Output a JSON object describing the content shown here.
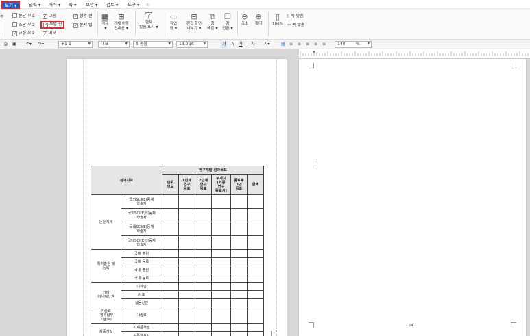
{
  "menubar": {
    "items": [
      {
        "label": "보기",
        "active": true
      },
      {
        "label": "입력"
      },
      {
        "label": "서식"
      },
      {
        "label": "쪽"
      },
      {
        "label": "보안"
      },
      {
        "label": "검토"
      },
      {
        "label": "도구"
      }
    ]
  },
  "ribbon": {
    "left_edge_label": "조",
    "checkboxes": [
      {
        "label": "문단 부호",
        "checked": false
      },
      {
        "label": "그림",
        "checked": true
      },
      {
        "label": "상황 선",
        "checked": true
      },
      {
        "label": "조판 부호",
        "checked": false
      },
      {
        "label": "투명 선",
        "checked": true,
        "highlighted": true
      },
      {
        "label": "문서 탭",
        "checked": true
      },
      {
        "label": "교정 부호",
        "checked": true
      },
      {
        "label": "메모",
        "checked": true
      }
    ],
    "buttons": {
      "grid": "격자",
      "grid_move": "개체 이동",
      "grid_move_2": "안내선",
      "hanja": "한자",
      "hanja_2": "발음 표시",
      "workspace": "작업",
      "workspace_2": "창",
      "edit_screen": "편집 화면",
      "edit_screen_2": "나누기",
      "window_arrange": "창",
      "window_arrange_2": "배열",
      "window_switch": "창",
      "window_switch_2": "전환",
      "zoom_out": "축소",
      "zoom_in": "확대",
      "zoom_100": "100%",
      "fit_page": "쪽 맞춤",
      "fit_width": "폭 맞춤"
    }
  },
  "toolbar": {
    "style": "바탕글",
    "style_prefix": "+1-1",
    "language": "대표",
    "font": "돋움",
    "size": "13.0",
    "size_unit": "pt",
    "bold": "가",
    "italic": "가",
    "underline": "가",
    "strike": "가",
    "zoom": "140",
    "zoom_unit": "%"
  },
  "document": {
    "table": {
      "header_perf": "성과지표",
      "header_goal": "연구개발 성과목표",
      "columns": [
        "단위\n연도",
        "1단계\n연구\n목표",
        "2단계\n연구\n목표",
        "누계치\n(최종\n연구\n종료시)",
        "종료후\n3년\n목표",
        "합계"
      ],
      "groups": [
        {
          "name": "논문게재",
          "rows": [
            "국외SCI(E)등재\n학술지",
            "국외SCI(E)비등재\n학술지",
            "국내SCI(E)등재\n학술지",
            "국내SCI(E)비등재\n학술지"
          ]
        },
        {
          "name": "특허출원 및\n등록",
          "rows": [
            "국제 출원",
            "국제 등록",
            "국내 출원",
            "국내 등록"
          ]
        },
        {
          "name": "기타\n지식재산권",
          "rows": [
            "디자인",
            "상표",
            "실용신안"
          ]
        },
        {
          "name": "기술료\n(정부납부\n기술료)",
          "rows": [
            "기술료"
          ]
        },
        {
          "name": "제품개발",
          "rows": [
            "시제품개발",
            "상품화실시"
          ]
        }
      ]
    },
    "page_number": "- 24 -"
  }
}
